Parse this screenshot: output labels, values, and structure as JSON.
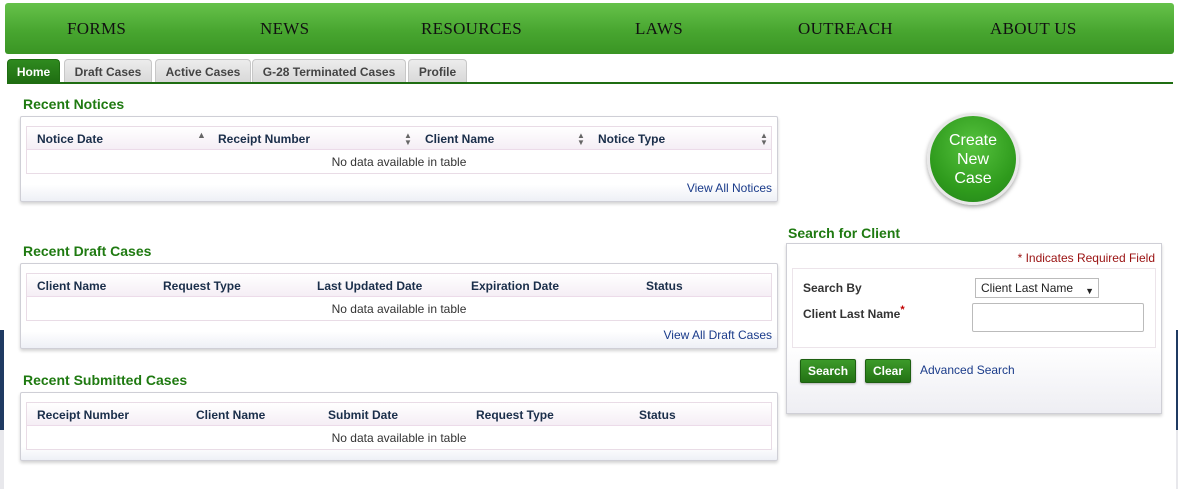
{
  "nav": {
    "items": [
      "FORMS",
      "NEWS",
      "RESOURCES",
      "LAWS",
      "OUTREACH",
      "ABOUT US"
    ]
  },
  "tabs": {
    "items": [
      "Home",
      "Draft Cases",
      "Active Cases",
      "G-28 Terminated Cases",
      "Profile"
    ],
    "active": "Home"
  },
  "notices": {
    "title": "Recent Notices",
    "columns": [
      "Notice Date",
      "Receipt Number",
      "Client Name",
      "Notice Type"
    ],
    "empty_text": "No data available in table",
    "view_all": "View All Notices"
  },
  "drafts": {
    "title": "Recent Draft Cases",
    "columns": [
      "Client Name",
      "Request Type",
      "Last Updated Date",
      "Expiration Date",
      "Status"
    ],
    "empty_text": "No data available in table",
    "view_all": "View All Draft Cases"
  },
  "submitted": {
    "title": "Recent Submitted Cases",
    "columns": [
      "Receipt Number",
      "Client Name",
      "Submit Date",
      "Request Type",
      "Status"
    ],
    "empty_text": "No data available in table"
  },
  "create_case": {
    "line1": "Create",
    "line2": "New",
    "line3": "Case"
  },
  "search": {
    "title": "Search for Client",
    "required_note": "* Indicates Required Field",
    "search_by_label": "Search By",
    "search_by_value": "Client Last Name",
    "last_name_label": "Client Last Name",
    "last_name_value": "",
    "search_button": "Search",
    "clear_button": "Clear",
    "advanced_link": "Advanced Search"
  },
  "colors": {
    "accent_green": "#1f7a11",
    "nav_green": "#48a630",
    "link_blue": "#1a3b8a",
    "required_red": "#9a1111",
    "navy": "#1f3a62"
  }
}
